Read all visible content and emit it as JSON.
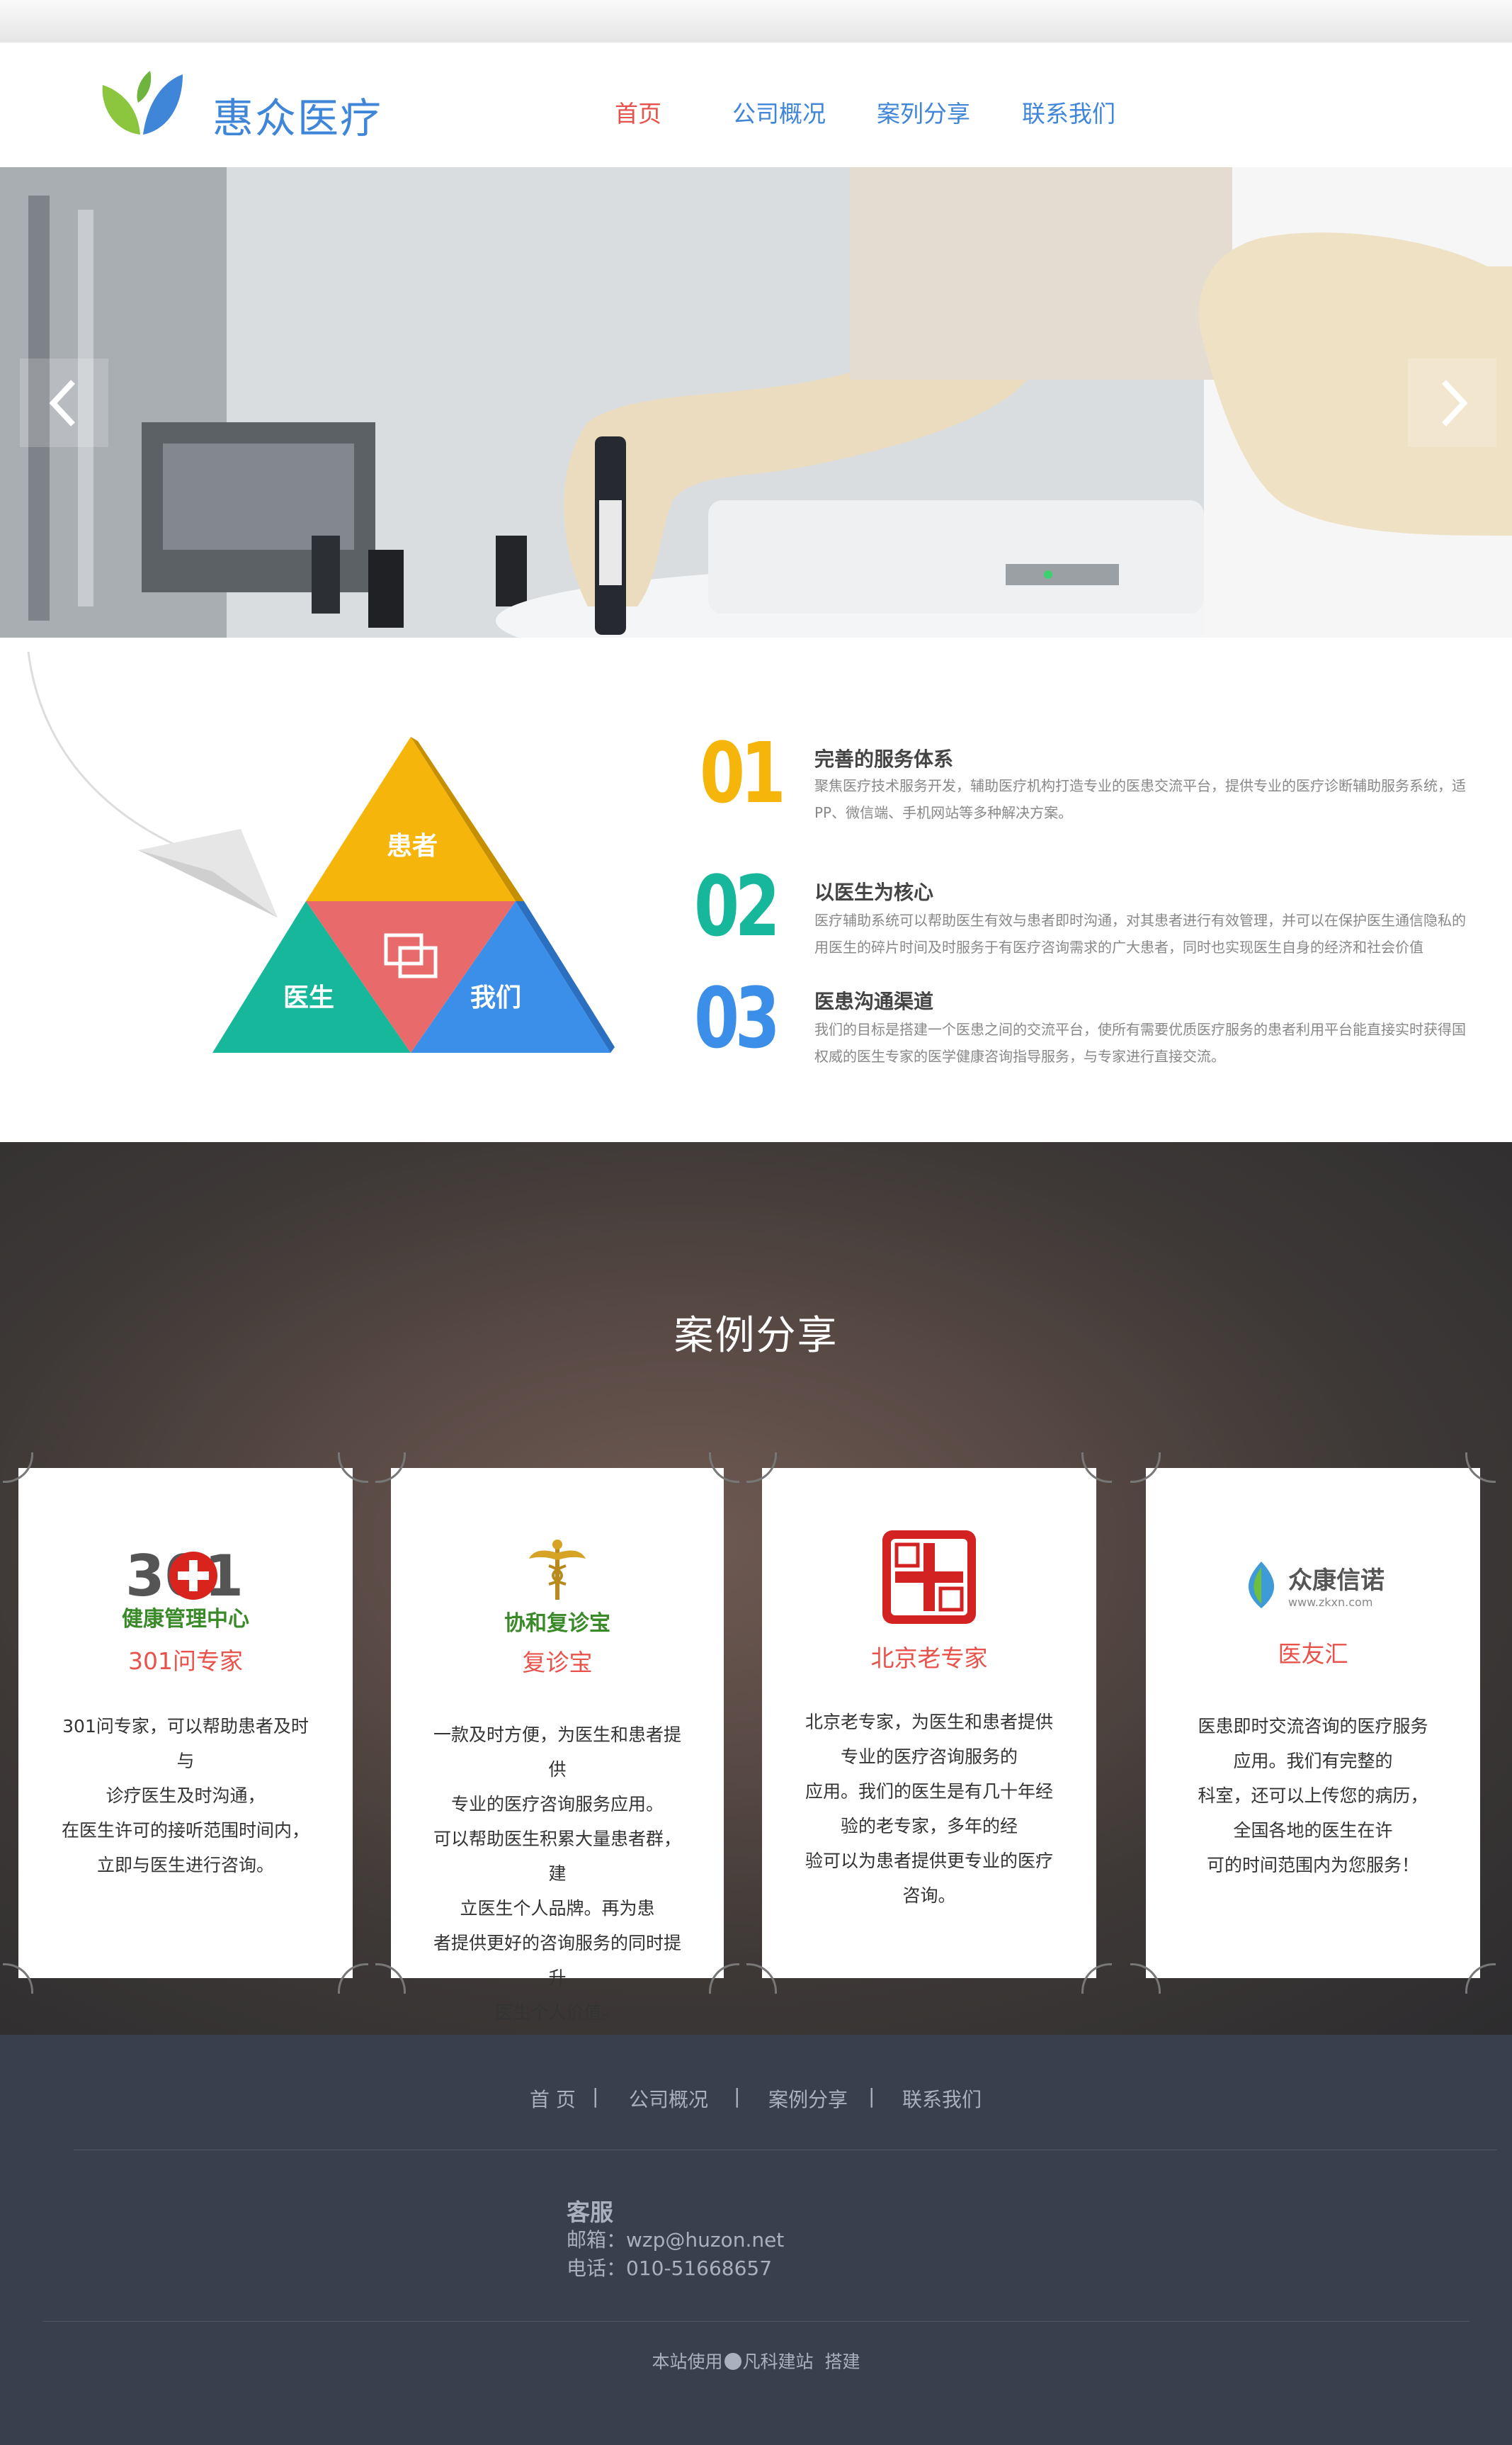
{
  "header": {
    "brand": "惠众医疗",
    "nav": [
      "首页",
      "公司概况",
      "案列分享",
      "联系我们"
    ],
    "active_index": 0
  },
  "banner": {
    "prev_icon": "chevron-left-icon",
    "next_icon": "chevron-right-icon"
  },
  "pyramid": {
    "top": "患者",
    "left": "医生",
    "right": "我们",
    "colors": {
      "top": "#f5b50a",
      "left": "#16b79a",
      "right": "#3b8fe8",
      "center": "#e86a6a"
    }
  },
  "features": [
    {
      "num": "01",
      "color": "#f5b50a",
      "title": "完善的服务体系",
      "desc_lines": [
        "聚焦医疗技术服务开发，辅助医疗机构打造专业的医患交流平台，提供专业的医疗诊断辅助服务系统，适",
        "PP、微信端、手机网站等多种解决方案。"
      ]
    },
    {
      "num": "02",
      "color": "#16b79a",
      "title": "以医生为核心",
      "desc_lines": [
        "医疗辅助系统可以帮助医生有效与患者即时沟通，对其患者进行有效管理，并可以在保护医生通信隐私的",
        "用医生的碎片时间及时服务于有医疗咨询需求的广大患者，同时也实现医生自身的经济和社会价值"
      ]
    },
    {
      "num": "03",
      "color": "#3b8fe8",
      "title": "医患沟通渠道",
      "desc_lines": [
        "我们的目标是搭建一个医患之间的交流平台，使所有需要优质医疗服务的患者利用平台能直接实时获得国",
        "权威的医生专家的医学健康咨询指导服务，与专家进行直接交流。"
      ]
    }
  ],
  "cases": {
    "title": "案例分享",
    "cards": [
      {
        "logo_text": "健康管理中心",
        "logo_mark": "301",
        "name": "301问专家",
        "desc_lines": [
          "301问专家，可以帮助患者及时与",
          "诊疗医生及时沟通，",
          "在医生许可的接听范围时间内，",
          "立即与医生进行咨询。"
        ]
      },
      {
        "logo_text": "协和复诊宝",
        "name": "复诊宝",
        "desc_lines": [
          "一款及时方便，为医生和患者提供",
          "专业的医疗咨询服务应用。",
          "可以帮助医生积累大量患者群，建",
          "立医生个人品牌。再为患",
          "者提供更好的咨询服务的同时提升",
          "医生个人价值。"
        ]
      },
      {
        "logo_text": "",
        "name": "北京老专家",
        "desc_lines": [
          "北京老专家，为医生和患者提供",
          "专业的医疗咨询服务的",
          "应用。我们的医生是有几十年经",
          "验的老专家，多年的经",
          "验可以为患者提供更专业的医疗",
          "咨询。"
        ]
      },
      {
        "logo_text": "众康信诺",
        "logo_sub": "www.zkxn.com",
        "name": "医友汇",
        "desc_lines": [
          "医患即时交流咨询的医疗服务",
          "应用。我们有完整的",
          "科室，还可以上传您的病历，",
          "全国各地的医生在许",
          "可的时间范围内为您服务！"
        ]
      }
    ]
  },
  "footer": {
    "nav": [
      "首 页",
      "公司概况",
      "案例分享",
      "联系我们"
    ],
    "service_title": "客服",
    "email": "邮箱：wzp@huzon.net",
    "phone": "电话：010-51668657",
    "copyright_prefix": "本站使用",
    "copyright_brand": "凡科建站",
    "copyright_suffix": "搭建"
  }
}
